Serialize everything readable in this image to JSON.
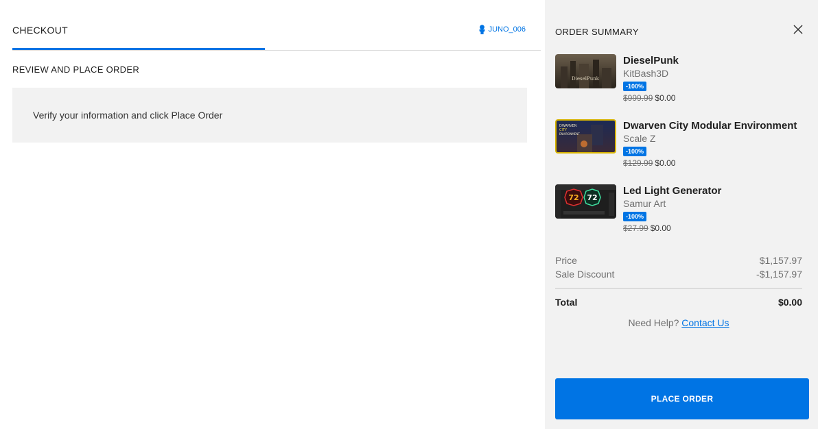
{
  "checkout": {
    "tab_label": "CHECKOUT",
    "username": "JUNO_006",
    "section_title": "REVIEW AND PLACE ORDER",
    "info_text": "Verify your information and click Place Order"
  },
  "summary": {
    "title": "ORDER SUMMARY",
    "items": [
      {
        "title": "DieselPunk",
        "publisher": "KitBash3D",
        "discount": "-100%",
        "old_price": "$999.99",
        "new_price": "$0.00",
        "thumb_icon": "dieselpunk-city-thumbnail"
      },
      {
        "title": "Dwarven City Modular Environment",
        "publisher": "Scale Z",
        "discount": "-100%",
        "old_price": "$129.99",
        "new_price": "$0.00",
        "thumb_icon": "dwarven-city-thumbnail"
      },
      {
        "title": "Led Light Generator",
        "publisher": "Samur Art",
        "discount": "-100%",
        "old_price": "$27.99",
        "new_price": "$0.00",
        "thumb_icon": "led-light-thumbnail"
      }
    ],
    "price_label": "Price",
    "price_value": "$1,157.97",
    "discount_label": "Sale Discount",
    "discount_value": "-$1,157.97",
    "total_label": "Total",
    "total_value": "$0.00",
    "help_text": "Need Help?",
    "help_link": "Contact Us",
    "place_order_label": "PLACE ORDER"
  },
  "colors": {
    "accent": "#0074e4",
    "panel_bg": "#f2f2f2"
  }
}
